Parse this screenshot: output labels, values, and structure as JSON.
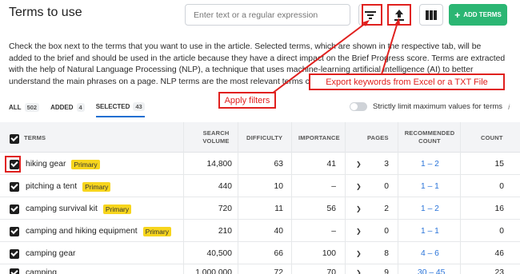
{
  "header": {
    "title": "Terms to use",
    "search_placeholder": "Enter text or a regular expression",
    "add_terms_label": "ADD TERMS"
  },
  "description": "Check the box next to the terms that you want to use in the article. Selected terms, which are shown in the respective tab, will be added to the brief and should be used in the article because they have a direct impact on the Brief Progress score. Terms are extracted with the help of Natural Language Processing (NLP), a technique that uses machine-learning artificial intelligence (AI) to better understand the main phrases on a page. NLP terms are the most relevant terms collected from active competitors' pages.",
  "tabs": [
    {
      "label": "ALL",
      "count": "502"
    },
    {
      "label": "ADDED",
      "count": "4"
    },
    {
      "label": "SELECTED",
      "count": "43"
    }
  ],
  "toggle_label": "Strictly limit maximum values for terms",
  "info_glyph": "i",
  "columns": {
    "terms": "TERMS",
    "search_volume": "SEARCH VOLUME",
    "difficulty": "DIFFICULTY",
    "importance": "IMPORTANCE",
    "pages": "PAGES",
    "recommended_count": "RECOMMENDED COUNT",
    "count": "COUNT"
  },
  "rows": [
    {
      "term": "hiking gear",
      "tag": "Primary",
      "volume": "14,800",
      "difficulty": "63",
      "importance": "41",
      "pages": "3",
      "recommended": "1 – 2",
      "count": "15"
    },
    {
      "term": "pitching a tent",
      "tag": "Primary",
      "volume": "440",
      "difficulty": "10",
      "importance": "–",
      "pages": "0",
      "recommended": "1 – 1",
      "count": "0"
    },
    {
      "term": "camping survival kit",
      "tag": "Primary",
      "volume": "720",
      "difficulty": "11",
      "importance": "56",
      "pages": "2",
      "recommended": "1 – 2",
      "count": "16"
    },
    {
      "term": "camping and hiking equipment",
      "tag": "Primary",
      "volume": "210",
      "difficulty": "40",
      "importance": "–",
      "pages": "0",
      "recommended": "1 – 1",
      "count": "0"
    },
    {
      "term": "camping gear",
      "tag": "",
      "volume": "40,500",
      "difficulty": "66",
      "importance": "100",
      "pages": "8",
      "recommended": "4 – 6",
      "count": "46"
    },
    {
      "term": "camping",
      "tag": "",
      "volume": "1,000,000",
      "difficulty": "72",
      "importance": "70",
      "pages": "9",
      "recommended": "30 – 45",
      "count": "23"
    }
  ],
  "annotations": {
    "apply_filters": "Apply filters",
    "export": "Export keywords from Excel or a TXT File"
  },
  "colors": {
    "accent_green": "#2bb673",
    "link_blue": "#2a74d9",
    "primary_tag": "#f7d51d",
    "annotation_red": "#e0201e"
  }
}
